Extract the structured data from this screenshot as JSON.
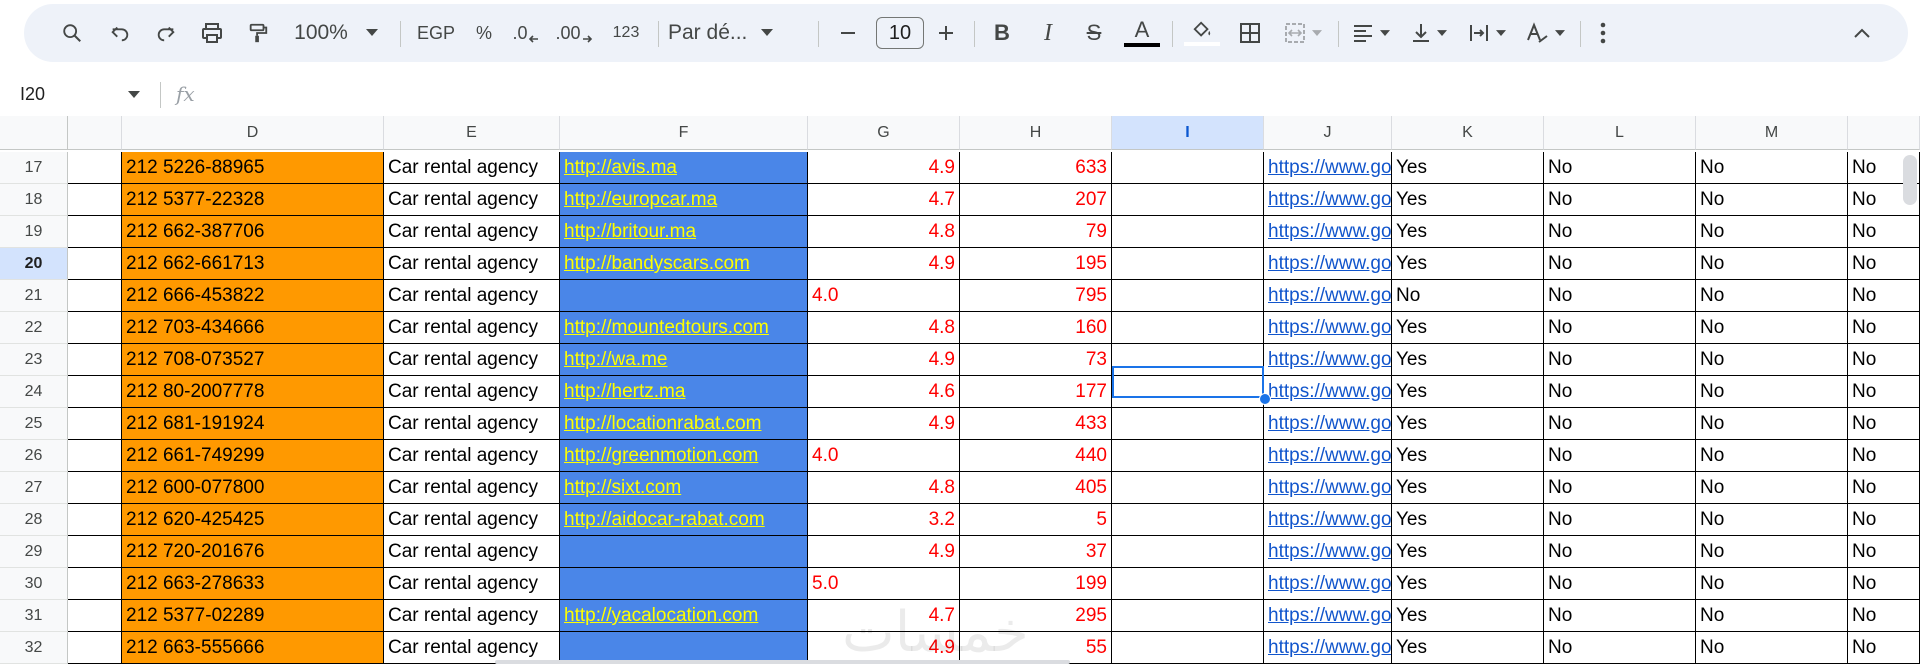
{
  "toolbar": {
    "zoom": "100%",
    "currency": "EGP",
    "percent": "%",
    "dec_decrease": ".0",
    "dec_increase": ".00",
    "number_format": "123",
    "font_name": "Par dé...",
    "font_size": "10"
  },
  "formula_bar": {
    "name_box": "I20",
    "fx_label": "fx",
    "value": ""
  },
  "columns": [
    "D",
    "E",
    "F",
    "G",
    "H",
    "I",
    "J",
    "K",
    "L",
    "M",
    ""
  ],
  "selected_column": "I",
  "selected_cell": "I20",
  "rows": [
    {
      "num": "17",
      "d": "212 5226-88965",
      "e": "Car rental agency",
      "f": "http://avis.ma ",
      "g": "4.9",
      "g_align": "right",
      "h": "633",
      "j": "https://www.go",
      "k": "Yes",
      "l": "No",
      "m": "No",
      "n": "No"
    },
    {
      "num": "18",
      "d": "212 5377-22328",
      "e": "Car rental agency",
      "f": "http://europcar.ma ",
      "g": "4.7",
      "g_align": "right",
      "h": "207",
      "j": "https://www.go",
      "k": "Yes",
      "l": "No",
      "m": "No",
      "n": "No"
    },
    {
      "num": "19",
      "d": "212 662-387706",
      "e": "Car rental agency",
      "f": "http://britour.ma ",
      "g": "4.8",
      "g_align": "right",
      "h": "79",
      "j": "https://www.go",
      "k": "Yes",
      "l": "No",
      "m": "No",
      "n": "No"
    },
    {
      "num": "20",
      "d": "212 662-661713",
      "e": "Car rental agency",
      "f": "http://bandyscars.com ",
      "g": "4.9",
      "g_align": "right",
      "h": "195",
      "j": "https://www.go",
      "k": "Yes",
      "l": "No",
      "m": "No",
      "n": "No"
    },
    {
      "num": "21",
      "d": "212 666-453822",
      "e": "Car rental agency",
      "f": "",
      "g": "4.0",
      "g_align": "left",
      "h": "795",
      "j": "https://www.go",
      "k": "No",
      "l": "No",
      "m": "No",
      "n": "No"
    },
    {
      "num": "22",
      "d": "212 703-434666",
      "e": "Car rental agency",
      "f": "http://mountedtours.com ",
      "g": "4.8",
      "g_align": "right",
      "h": "160",
      "j": "https://www.go",
      "k": "Yes",
      "l": "No",
      "m": "No",
      "n": "No"
    },
    {
      "num": "23",
      "d": "212 708-073527",
      "e": "Car rental agency",
      "f": "http://wa.me ",
      "g": "4.9",
      "g_align": "right",
      "h": "73",
      "j": "https://www.go",
      "k": "Yes",
      "l": "No",
      "m": "No",
      "n": "No"
    },
    {
      "num": "24",
      "d": "212 80-2007778",
      "e": "Car rental agency",
      "f": "http://hertz.ma ",
      "g": "4.6",
      "g_align": "right",
      "h": "177",
      "j": "https://www.go",
      "k": "Yes",
      "l": "No",
      "m": "No",
      "n": "No"
    },
    {
      "num": "25",
      "d": "212 681-191924",
      "e": "Car rental agency",
      "f": "http://locationrabat.com ",
      "g": "4.9",
      "g_align": "right",
      "h": "433",
      "j": "https://www.go",
      "k": "Yes",
      "l": "No",
      "m": "No",
      "n": "No"
    },
    {
      "num": "26",
      "d": "212 661-749299",
      "e": "Car rental agency",
      "f": "http://greenmotion.com ",
      "g": "4.0",
      "g_align": "left",
      "h": "440",
      "j": "https://www.go",
      "k": "Yes",
      "l": "No",
      "m": "No",
      "n": "No"
    },
    {
      "num": "27",
      "d": "212 600-077800",
      "e": "Car rental agency",
      "f": "http://sixt.com ",
      "g": "4.8",
      "g_align": "right",
      "h": "405",
      "j": "https://www.go",
      "k": "Yes",
      "l": "No",
      "m": "No",
      "n": "No"
    },
    {
      "num": "28",
      "d": "212 620-425425",
      "e": "Car rental agency",
      "f": "http://aidocar-rabat.com ",
      "g": "3.2",
      "g_align": "right",
      "h": "5",
      "j": "https://www.go",
      "k": "Yes",
      "l": "No",
      "m": "No",
      "n": "No"
    },
    {
      "num": "29",
      "d": "212 720-201676",
      "e": "Car rental agency",
      "f": "",
      "g": "4.9",
      "g_align": "right",
      "h": "37",
      "j": "https://www.go",
      "k": "Yes",
      "l": "No",
      "m": "No",
      "n": "No"
    },
    {
      "num": "30",
      "d": "212 663-278633",
      "e": "Car rental agency",
      "f": "",
      "g": "5.0",
      "g_align": "left",
      "h": "199",
      "j": "https://www.go",
      "k": "Yes",
      "l": "No",
      "m": "No",
      "n": "No"
    },
    {
      "num": "31",
      "d": "212 5377-02289",
      "e": "Car rental agency",
      "f": "http://yacalocation.com ",
      "g": "4.7",
      "g_align": "right",
      "h": "295",
      "j": "https://www.go",
      "k": "Yes",
      "l": "No",
      "m": "No",
      "n": "No"
    },
    {
      "num": "32",
      "d": "212 663-555666",
      "e": "Car rental agency",
      "f": "",
      "g": "4.9",
      "g_align": "right",
      "h": "55",
      "j": "https://www.go",
      "k": "Yes",
      "l": "No",
      "m": "No",
      "n": "No"
    }
  ],
  "watermark": "خمسات",
  "colors": {
    "phone_fill": "#ff9900",
    "url_fill": "#4a86e8",
    "url_text": "#ffff00",
    "number_text": "#ff0000",
    "link_text": "#1155cc",
    "selection": "#1a73e8"
  }
}
